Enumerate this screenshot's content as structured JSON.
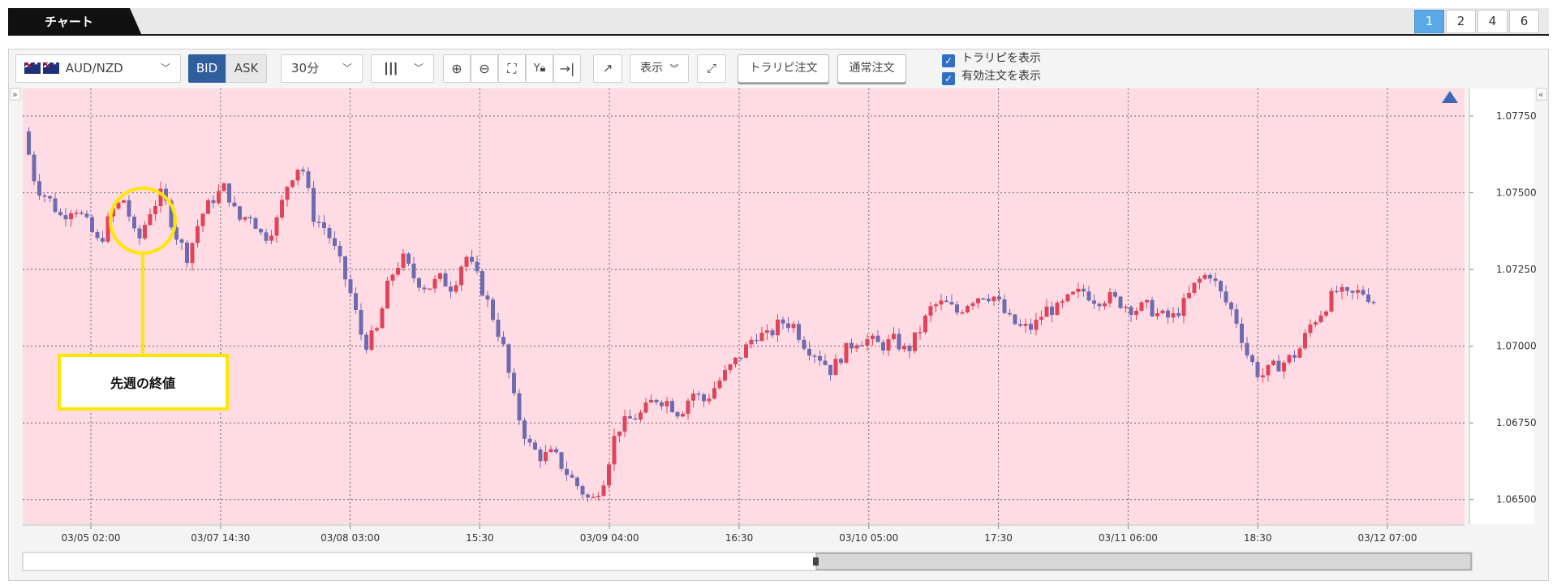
{
  "header": {
    "tab_label": "チャート",
    "layouts": [
      "1",
      "2",
      "4",
      "6"
    ],
    "active_layout": "1"
  },
  "toolbar": {
    "pair": "AUD/NZD",
    "bid_label": "BID",
    "ask_label": "ASK",
    "interval": "30分",
    "display_label": "表示",
    "trail_order_label": "トラリピ注文",
    "normal_order_label": "通常注文",
    "show_trail_label": "トラリピを表示",
    "show_orders_label": "有効注文を表示",
    "left_collapse": "»",
    "right_collapse": "«"
  },
  "annotation": {
    "label": "先週の終値",
    "color": "#ffe600"
  },
  "colors": {
    "background": "#ffdce3",
    "up": "#e0435a",
    "down": "#6f6bb0",
    "accent": "#2f5e9e"
  },
  "chart_data": {
    "type": "candlestick",
    "y_ticks": [
      "1.07750",
      "1.07500",
      "1.07250",
      "1.07000",
      "1.06750",
      "1.06500"
    ],
    "ylim": [
      1.0642,
      1.0784
    ],
    "x_ticks": [
      "03/05 02:00",
      "03/07 14:30",
      "03/08 03:00",
      "15:30",
      "03/09 04:00",
      "16:30",
      "03/10 05:00",
      "17:30",
      "03/11 06:00",
      "18:30",
      "03/12 07:00"
    ],
    "close_path": [
      1.077,
      1.0752,
      1.0748,
      1.0742,
      1.0746,
      1.074,
      1.0733,
      1.0744,
      1.0748,
      1.0733,
      1.0744,
      1.075,
      1.0737,
      1.0729,
      1.0742,
      1.0748,
      1.0752,
      1.0741,
      1.0743,
      1.0735,
      1.074,
      1.0754,
      1.076,
      1.0742,
      1.0738,
      1.0728,
      1.0716,
      1.07,
      1.0705,
      1.0722,
      1.0729,
      1.0722,
      1.0719,
      1.0722,
      1.0719,
      1.073,
      1.0722,
      1.0712,
      1.07,
      1.068,
      1.0668,
      1.0664,
      1.0665,
      1.0659,
      1.0654,
      1.0649,
      1.0657,
      1.0673,
      1.0676,
      1.0678,
      1.0683,
      1.0682,
      1.0678,
      1.0685,
      1.0682,
      1.0688,
      1.0693,
      1.0698,
      1.0704,
      1.0703,
      1.0708,
      1.0707,
      1.07,
      1.0697,
      1.0692,
      1.0698,
      1.0702,
      1.0702,
      1.07,
      1.0702,
      1.0698,
      1.0705,
      1.0713,
      1.0714,
      1.0711,
      1.0715,
      1.0717,
      1.0716,
      1.0709,
      1.0706,
      1.0706,
      1.0712,
      1.0712,
      1.0716,
      1.0718,
      1.0715,
      1.0716,
      1.0714,
      1.0712,
      1.0713,
      1.071,
      1.0709,
      1.0714,
      1.0721,
      1.0724,
      1.0716,
      1.071,
      1.0697,
      1.069,
      1.0693,
      1.0695,
      1.0698,
      1.0707,
      1.0712,
      1.0718,
      1.0716,
      1.0718,
      1.0715
    ]
  }
}
